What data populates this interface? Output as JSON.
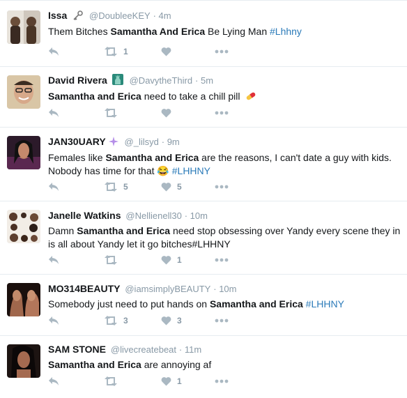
{
  "colors": {
    "icon": "#aab8c2",
    "meta": "#8899a6",
    "link": "#2b7bb9",
    "border": "#e6ecf0"
  },
  "tweets": [
    {
      "fullname": "Issa",
      "emoji": "key-icon",
      "username": "@DoubleeKEY",
      "time": "4m",
      "segments": [
        {
          "t": "Them Bitches ",
          "b": false
        },
        {
          "t": "Samantha And Erica",
          "b": true
        },
        {
          "t": " Be Lying Man ",
          "b": false
        },
        {
          "t": "#Lhhny",
          "h": true
        }
      ],
      "retweets": "1",
      "likes": ""
    },
    {
      "fullname": "David Rivera",
      "emoji": "statue-of-liberty-icon",
      "username": "@DavytheThird",
      "time": "5m",
      "segments": [
        {
          "t": "Samantha and Erica",
          "b": true
        },
        {
          "t": " need to take a chill pill ",
          "b": false
        }
      ],
      "trailing_emoji": "pill-icon",
      "retweets": "",
      "likes": ""
    },
    {
      "fullname": "JAN30UARY",
      "emoji": "sparkles-icon",
      "username": "@_lilsyd",
      "time": "9m",
      "segments": [
        {
          "t": "Females like ",
          "b": false
        },
        {
          "t": "Samantha and Erica",
          "b": true
        },
        {
          "t": " are the reasons, I can't date a guy with kids. Nobody has time for that ",
          "b": false
        },
        {
          "t": "😂 ",
          "e": true
        },
        {
          "t": "#LHHNY",
          "h": true
        }
      ],
      "retweets": "5",
      "likes": "5"
    },
    {
      "fullname": "Janelle Watkins",
      "emoji": "",
      "username": "@Nellienell30",
      "time": "10m",
      "segments": [
        {
          "t": "Damn ",
          "b": false
        },
        {
          "t": "Samantha and Erica",
          "b": true
        },
        {
          "t": " need stop obsessing over Yandy every scene they in is all about Yandy let it go bitches#LHHNY",
          "b": false
        }
      ],
      "retweets": "",
      "likes": "1"
    },
    {
      "fullname": "MO314BEAUTY",
      "emoji": "",
      "username": "@iamsimplyBEAUTY",
      "time": "10m",
      "segments": [
        {
          "t": "Somebody just need to put hands on ",
          "b": false
        },
        {
          "t": "Samantha and Erica",
          "b": true
        },
        {
          "t": " ",
          "b": false
        },
        {
          "t": "#LHHNY",
          "h": true
        }
      ],
      "retweets": "3",
      "likes": "3"
    },
    {
      "fullname": "SAM STONE",
      "emoji": "",
      "username": "@livecreatebeat",
      "time": "11m",
      "segments": [
        {
          "t": "Samantha and Erica",
          "b": true
        },
        {
          "t": " are annoying af",
          "b": false
        }
      ],
      "retweets": "",
      "likes": "1"
    }
  ]
}
